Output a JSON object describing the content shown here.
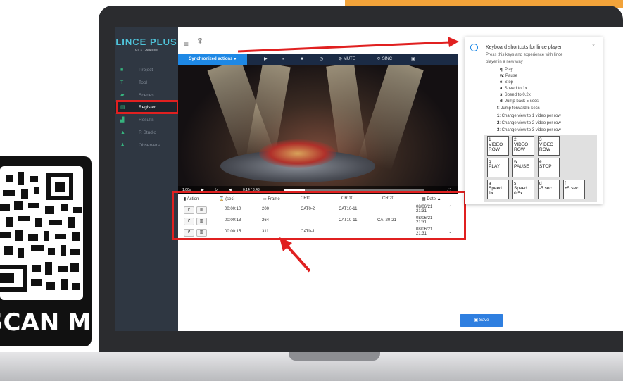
{
  "qr": {
    "label": "SCAN ME"
  },
  "app": {
    "title": "LINCE PLUS",
    "version": "v1.3.1-release"
  },
  "sidebar": {
    "items": [
      {
        "label": "Project",
        "icon": "briefcase-icon"
      },
      {
        "label": "Tool",
        "icon": "t-icon"
      },
      {
        "label": "Scenes",
        "icon": "camera-icon"
      },
      {
        "label": "Register",
        "icon": "register-icon"
      },
      {
        "label": "Results",
        "icon": "chart-icon"
      },
      {
        "label": "R Studio",
        "icon": "flask-icon"
      },
      {
        "label": "Observers",
        "icon": "users-icon"
      }
    ]
  },
  "toolbar": {
    "sync_label": "Synchronized actions",
    "play": "▶",
    "pause": "⏸",
    "stop": "■",
    "timer": "◷",
    "mute": "MUTE",
    "sinc": "SINC"
  },
  "player": {
    "speed": "1.00x",
    "time": "0:14 / 3:43"
  },
  "table": {
    "headers": [
      "Action",
      "(sec)",
      "Frame",
      "CRI0",
      "CRI10",
      "CRI20",
      "Date ▲"
    ],
    "rows": [
      {
        "sec": "00:00:10",
        "frame": "200",
        "cri0": "CAT0-2",
        "cri10": "CAT10-11",
        "cri20": "",
        "date": "08/06/21 21:31"
      },
      {
        "sec": "00:00:13",
        "frame": "264",
        "cri0": "",
        "cri10": "CAT10-11",
        "cri20": "CAT20-21",
        "date": "08/06/21 21:31"
      },
      {
        "sec": "00:00:15",
        "frame": "311",
        "cri0": "CAT0-1",
        "cri10": "",
        "cri20": "",
        "date": "08/06/21 21:31"
      }
    ]
  },
  "shortcuts": {
    "title": "Keyboard shortcuts for lince player",
    "desc1": "Press this keys and experience with lince",
    "desc2": "player in a new way",
    "lines": [
      {
        "key": "q",
        "text": ": Play"
      },
      {
        "key": "w",
        "text": ": Pause"
      },
      {
        "key": "e",
        "text": ": Stop"
      },
      {
        "key": "a",
        "text": ": Speed to 1x"
      },
      {
        "key": "s",
        "text": ": Speed to 0.2x"
      },
      {
        "key": "d",
        "text": ": Jump back 5 secs"
      },
      {
        "key": "f",
        "text": ": Jump forward 5 secs"
      },
      {
        "key": "1",
        "text": ": Change view to 1 video per row"
      },
      {
        "key": "2",
        "text": ": Change view to 2 video per row"
      },
      {
        "key": "3",
        "text": ": Change view to 3 video per row"
      }
    ],
    "keys": [
      {
        "k": "1",
        "t": "VIDEO ROW"
      },
      {
        "k": "2",
        "t": "VIDEO ROW"
      },
      {
        "k": "3",
        "t": "VIDEO ROW"
      },
      {
        "k": "q",
        "t": "PLAY"
      },
      {
        "k": "w",
        "t": "PAUSE"
      },
      {
        "k": "e",
        "t": "STOP"
      },
      {
        "k": "a",
        "t": "Speed 1x"
      },
      {
        "k": "s",
        "t": "Speed 0.5x"
      },
      {
        "k": "d",
        "t": "-5 sec"
      },
      {
        "k": "f",
        "t": "+5 sec"
      }
    ]
  },
  "save": {
    "label": "Save"
  },
  "colors": {
    "accent": "#1e88e5",
    "highlight": "#e02020",
    "sidebar": "#2f3742",
    "brand": "#4fc3d9"
  }
}
